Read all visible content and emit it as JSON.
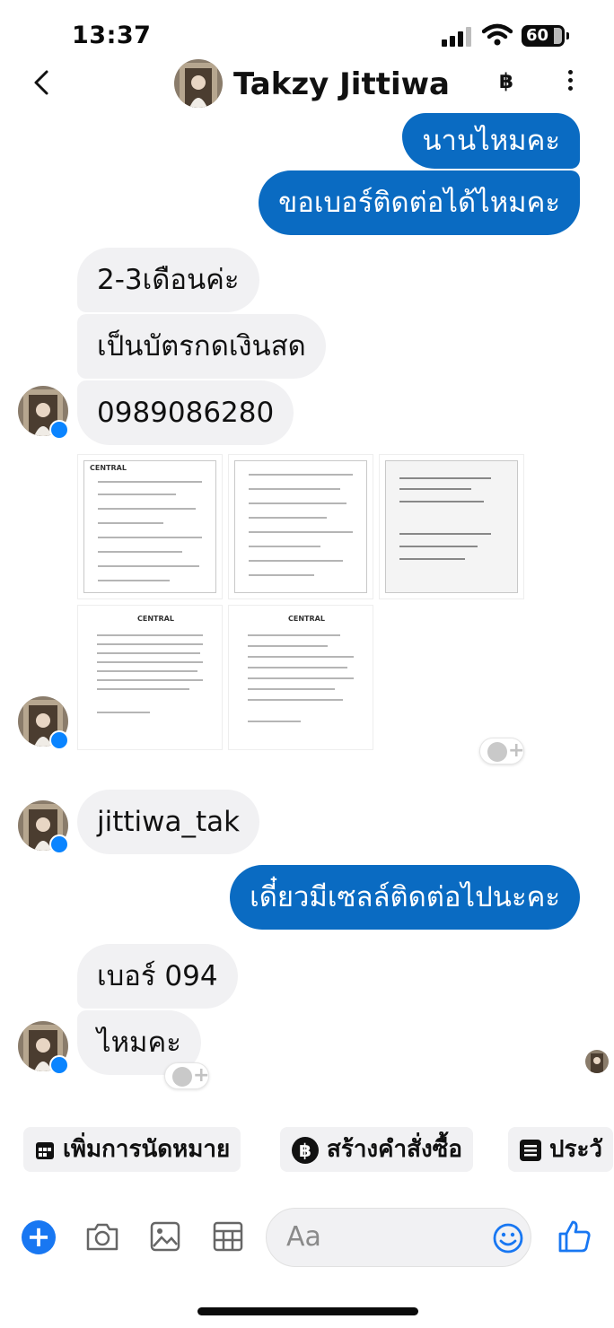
{
  "status": {
    "time": "13:37",
    "battery": "60"
  },
  "header": {
    "contact_name": "Takzy Jittiwa",
    "baht_symbol": "฿"
  },
  "messages": [
    {
      "dir": "out",
      "text": "นานไหมคะ"
    },
    {
      "dir": "out",
      "text": "ขอเบอร์ติดต่อได้ไหมคะ"
    },
    {
      "dir": "in",
      "text": "2-3เดือนค่ะ"
    },
    {
      "dir": "in",
      "text": "เป็นบัตรกดเงินสด"
    },
    {
      "dir": "in",
      "text": "0989086280"
    },
    {
      "dir": "in",
      "type": "photos",
      "count": 5
    },
    {
      "dir": "in",
      "text": "jittiwa_tak"
    },
    {
      "dir": "out",
      "text": "เดี๋ยวมีเซลล์ติดต่อไปนะคะ"
    },
    {
      "dir": "in",
      "text": "เบอร์ 094"
    },
    {
      "dir": "in",
      "text": "ไหมคะ"
    }
  ],
  "photo_brand": "CENTRAL",
  "quick_actions": [
    {
      "label": "เพิ่มการนัดหมาย",
      "icon": "calendar-icon"
    },
    {
      "label": "สร้างคำสั่งซื้อ",
      "icon": "baht-icon"
    },
    {
      "label": "ประวั",
      "icon": "list-icon"
    }
  ],
  "composer": {
    "placeholder": "Aa"
  },
  "colors": {
    "accent": "#0a6bc2",
    "incoming": "#f1f1f3",
    "messenger_blue": "#0a84ff"
  }
}
